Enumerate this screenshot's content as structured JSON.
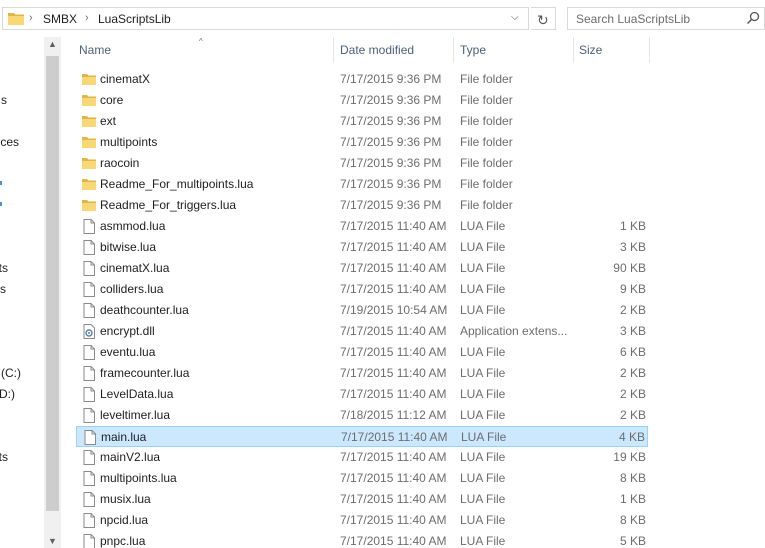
{
  "address": {
    "breadcrumbs": [
      "SMBX",
      "LuaScriptsLib"
    ],
    "separator": "›",
    "dropdown_glyph": "⌵",
    "refresh_glyph": "↻"
  },
  "search": {
    "placeholder": "Search LuaScriptsLib"
  },
  "nav": {
    "items": [
      {
        "label": "s"
      },
      {
        "label": "ces"
      },
      {
        "label": "ts"
      },
      {
        "label": "s"
      },
      {
        "label": "(C:)"
      },
      {
        "label": "D:)"
      },
      {
        "label": "ts"
      }
    ]
  },
  "columns": {
    "name": "Name",
    "date": "Date modified",
    "type": "Type",
    "size": "Size",
    "sort_glyph": "^"
  },
  "files": [
    {
      "name": "cinematX",
      "date": "7/17/2015 9:36 PM",
      "type": "File folder",
      "size": "",
      "icon": "folder-icon"
    },
    {
      "name": "core",
      "date": "7/17/2015 9:36 PM",
      "type": "File folder",
      "size": "",
      "icon": "folder-icon"
    },
    {
      "name": "ext",
      "date": "7/17/2015 9:36 PM",
      "type": "File folder",
      "size": "",
      "icon": "folder-icon"
    },
    {
      "name": "multipoints",
      "date": "7/17/2015 9:36 PM",
      "type": "File folder",
      "size": "",
      "icon": "folder-icon"
    },
    {
      "name": "raocoin",
      "date": "7/17/2015 9:36 PM",
      "type": "File folder",
      "size": "",
      "icon": "folder-icon"
    },
    {
      "name": "Readme_For_multipoints.lua",
      "date": "7/17/2015 9:36 PM",
      "type": "File folder",
      "size": "",
      "icon": "folder-icon"
    },
    {
      "name": "Readme_For_triggers.lua",
      "date": "7/17/2015 9:36 PM",
      "type": "File folder",
      "size": "",
      "icon": "folder-icon"
    },
    {
      "name": "asmmod.lua",
      "date": "7/17/2015 11:40 AM",
      "type": "LUA File",
      "size": "1 KB",
      "icon": "file-icon"
    },
    {
      "name": "bitwise.lua",
      "date": "7/17/2015 11:40 AM",
      "type": "LUA File",
      "size": "3 KB",
      "icon": "file-icon"
    },
    {
      "name": "cinematX.lua",
      "date": "7/17/2015 11:40 AM",
      "type": "LUA File",
      "size": "90 KB",
      "icon": "file-icon"
    },
    {
      "name": "colliders.lua",
      "date": "7/17/2015 11:40 AM",
      "type": "LUA File",
      "size": "9 KB",
      "icon": "file-icon"
    },
    {
      "name": "deathcounter.lua",
      "date": "7/19/2015 10:54 AM",
      "type": "LUA File",
      "size": "2 KB",
      "icon": "file-icon"
    },
    {
      "name": "encrypt.dll",
      "date": "7/17/2015 11:40 AM",
      "type": "Application extens...",
      "size": "3 KB",
      "icon": "dll-icon"
    },
    {
      "name": "eventu.lua",
      "date": "7/17/2015 11:40 AM",
      "type": "LUA File",
      "size": "6 KB",
      "icon": "file-icon"
    },
    {
      "name": "framecounter.lua",
      "date": "7/17/2015 11:40 AM",
      "type": "LUA File",
      "size": "2 KB",
      "icon": "file-icon"
    },
    {
      "name": "LevelData.lua",
      "date": "7/17/2015 11:40 AM",
      "type": "LUA File",
      "size": "2 KB",
      "icon": "file-icon"
    },
    {
      "name": "leveltimer.lua",
      "date": "7/18/2015 11:12 AM",
      "type": "LUA File",
      "size": "2 KB",
      "icon": "file-icon"
    },
    {
      "name": "main.lua",
      "date": "7/17/2015 11:40 AM",
      "type": "LUA File",
      "size": "4 KB",
      "icon": "file-icon",
      "selected": true
    },
    {
      "name": "mainV2.lua",
      "date": "7/17/2015 11:40 AM",
      "type": "LUA File",
      "size": "19 KB",
      "icon": "file-icon"
    },
    {
      "name": "multipoints.lua",
      "date": "7/17/2015 11:40 AM",
      "type": "LUA File",
      "size": "8 KB",
      "icon": "file-icon"
    },
    {
      "name": "musix.lua",
      "date": "7/17/2015 11:40 AM",
      "type": "LUA File",
      "size": "1 KB",
      "icon": "file-icon"
    },
    {
      "name": "npcid.lua",
      "date": "7/17/2015 11:40 AM",
      "type": "LUA File",
      "size": "8 KB",
      "icon": "file-icon"
    },
    {
      "name": "pnpc.lua",
      "date": "7/17/2015 11:40 AM",
      "type": "LUA File",
      "size": "5 KB",
      "icon": "file-icon"
    }
  ],
  "colors": {
    "selection_bg": "#cce8ff",
    "selection_border": "#99d1ff",
    "folder_yellow": "#f8d775",
    "header_text": "#4c607a"
  }
}
